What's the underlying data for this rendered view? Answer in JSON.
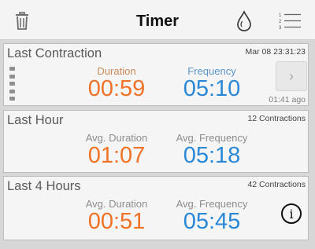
{
  "header": {
    "title": "Timer",
    "icons": [
      "trash-icon",
      "drop-icon",
      "numbered-list-icon"
    ]
  },
  "cards": [
    {
      "title": "Last Contraction",
      "timestamp": "Mar 08 23:31:23",
      "duration_label": "Duration",
      "duration_value": "00:59",
      "frequency_label": "Frequency",
      "frequency_value": "05:10",
      "ago": "01:41 ago",
      "next_icon": "›"
    },
    {
      "title": "Last Hour",
      "count": "12 Contractions",
      "duration_label": "Avg. Duration",
      "duration_value": "01:07",
      "frequency_label": "Avg. Frequency",
      "frequency_value": "05:18"
    },
    {
      "title": "Last 4 Hours",
      "count": "42 Contractions",
      "duration_label": "Avg. Duration",
      "duration_value": "00:51",
      "frequency_label": "Avg. Frequency",
      "frequency_value": "05:45",
      "info_icon": "i"
    }
  ],
  "colors": {
    "duration": "#f07226",
    "frequency": "#2a88d6"
  }
}
